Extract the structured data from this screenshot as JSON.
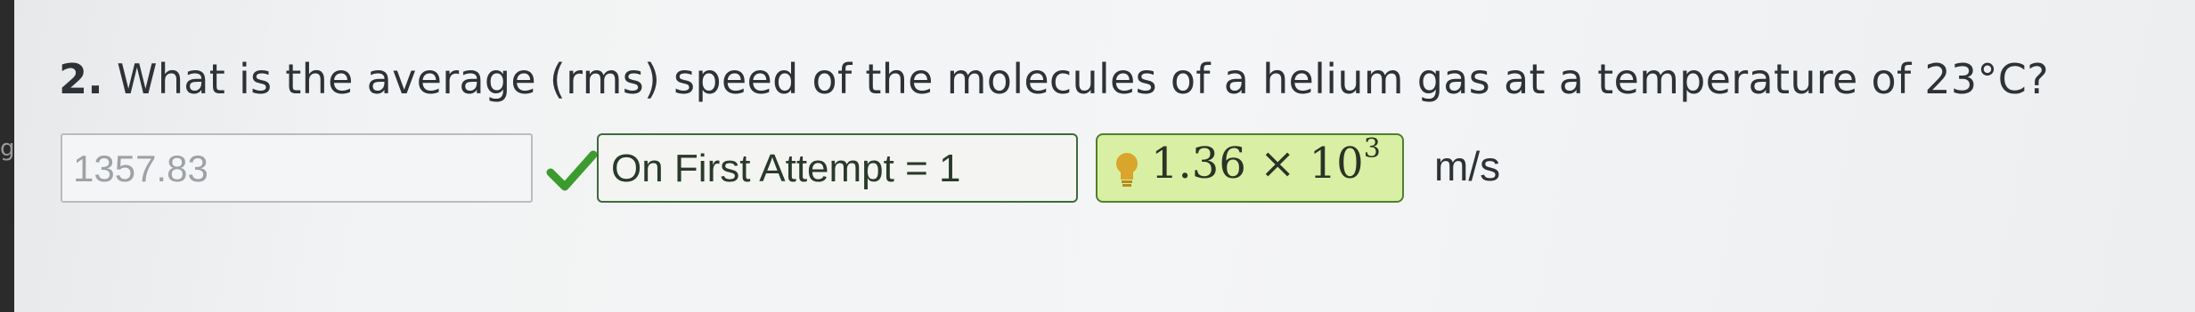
{
  "edge_text": "ga",
  "question": {
    "number": "2.",
    "text": "What is the average (rms) speed of the molecules of a helium gas at a temperature of 23°C?"
  },
  "answer_field": {
    "value": "1357.83"
  },
  "feedback": {
    "status_icon": "check-icon",
    "attempt_text": "On First Attempt = 1"
  },
  "correct_answer": {
    "icon": "lightbulb-icon",
    "mantissa": "1.36 × 10",
    "exponent": "3"
  },
  "units": "m/s",
  "colors": {
    "check": "#3c9b2e",
    "attempt_border": "#3d6a3d",
    "hint_bg": "#d9f0a4",
    "hint_border": "#4e7f2c",
    "bulb": "#d9a52a"
  }
}
